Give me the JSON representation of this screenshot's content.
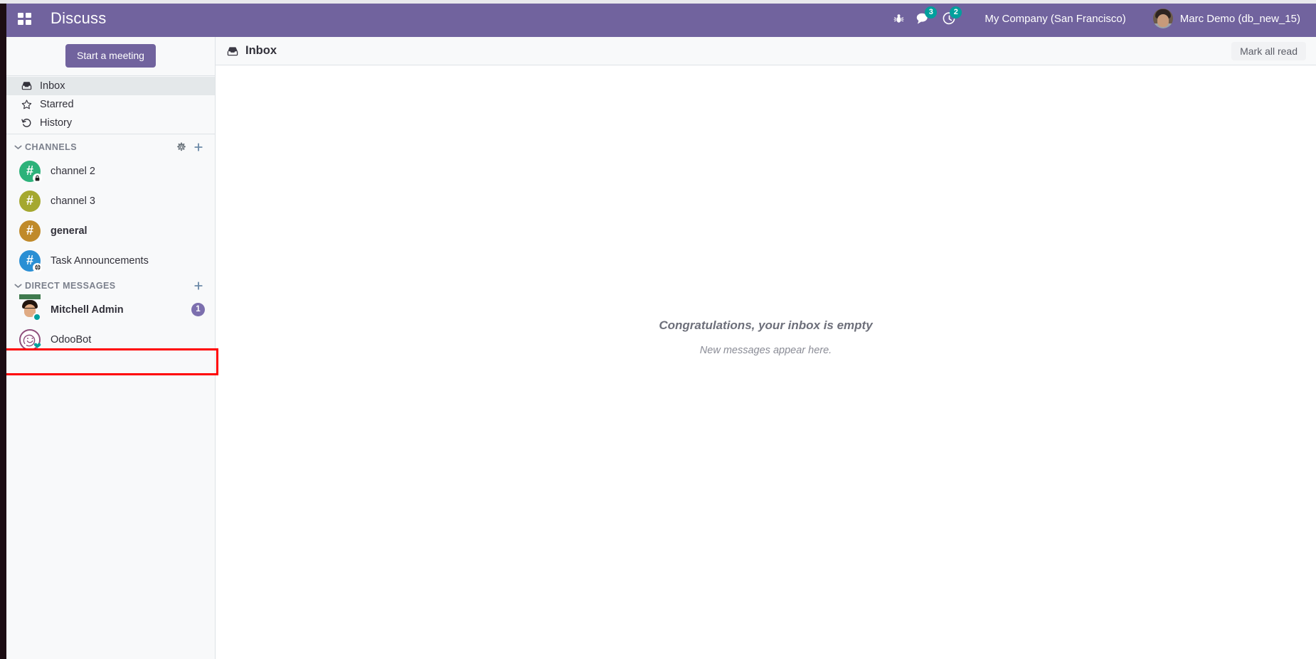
{
  "navbar": {
    "apps_icon": "apps-grid-icon",
    "brand": "Discuss",
    "systray": [
      {
        "icon": "bug-icon",
        "name": "debug-menu",
        "badge": null
      },
      {
        "icon": "comments-icon",
        "name": "messages-menu",
        "badge": "3"
      },
      {
        "icon": "clock-icon",
        "name": "activities-menu",
        "badge": "2"
      }
    ],
    "company": "My Company (San Francisco)",
    "user": "Marc Demo (db_new_15)",
    "brand_color": "#71639e",
    "badge_color": "#00a09d"
  },
  "sidebar": {
    "start_meeting_label": "Start a meeting",
    "mailboxes": [
      {
        "label": "Inbox",
        "icon": "inbox-icon",
        "active": true
      },
      {
        "label": "Starred",
        "icon": "star-icon",
        "active": false
      },
      {
        "label": "History",
        "icon": "history-icon",
        "active": false
      }
    ],
    "channels_section": {
      "title": "CHANNELS",
      "caret": "chevron-down-icon",
      "actions": [
        {
          "icon": "gear-icon",
          "name": "channel-settings-icon"
        },
        {
          "icon": "plus-icon",
          "name": "add-channel-icon"
        }
      ],
      "items": [
        {
          "name": "channel 2",
          "avatar_color": "#2cb27a",
          "glyph": "#",
          "badge_icon": "lock-icon",
          "unread": false,
          "count": null
        },
        {
          "name": "channel 3",
          "avatar_color": "#a5a82f",
          "glyph": "#",
          "badge_icon": null,
          "unread": false,
          "count": null
        },
        {
          "name": "general",
          "avatar_color": "#c08a2a",
          "glyph": "#",
          "badge_icon": null,
          "unread": true,
          "count": null
        },
        {
          "name": "Task Announcements",
          "avatar_color": "#2a8fd4",
          "glyph": "#",
          "badge_icon": "globe-icon",
          "unread": false,
          "count": null
        }
      ]
    },
    "dm_section": {
      "title": "DIRECT MESSAGES",
      "caret": "chevron-down-icon",
      "actions": [
        {
          "icon": "plus-icon",
          "name": "add-direct-message-icon"
        }
      ],
      "items": [
        {
          "name": "Mitchell Admin",
          "avatar_type": "photo",
          "status": "online",
          "unread": true,
          "count": "1",
          "highlighted": true
        },
        {
          "name": "OdooBot",
          "avatar_type": "bot",
          "status": "bot",
          "unread": false,
          "count": null,
          "highlighted": false
        }
      ]
    },
    "unread_badge_color": "#7c6fae",
    "online_color": "#00a09d"
  },
  "main": {
    "thread_icon": "inbox-icon",
    "thread_title": "Inbox",
    "mark_all_read_label": "Mark all read",
    "empty_title": "Congratulations, your inbox is empty",
    "empty_subtitle": "New messages appear here."
  },
  "annotation": {
    "target": "Mitchell Admin",
    "color": "#ff0000"
  }
}
